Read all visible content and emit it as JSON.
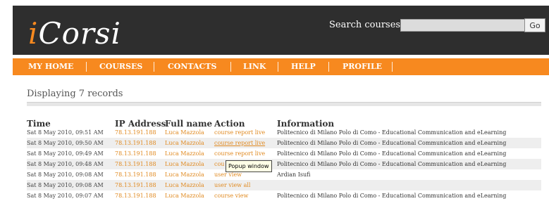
{
  "brand": {
    "logo_first": "i",
    "logo_rest": "Corsi"
  },
  "search": {
    "label": "Search courses",
    "value": "",
    "go_label": "Go"
  },
  "nav": {
    "items": [
      "MY HOME",
      "COURSES",
      "CONTACTS",
      "LINK",
      "HELP",
      "PROFILE"
    ]
  },
  "records_label": "Displaying 7 records",
  "table": {
    "headers": [
      "Time",
      "IP Address",
      "Full name",
      "Action",
      "Information"
    ],
    "rows": [
      {
        "time": "Sat 8 May 2010, 09:51 AM",
        "ip": "78.13.191.188",
        "name": "Luca Mazzola",
        "action": "course report live",
        "info": "Politecnico di Milano Polo di Como - Educational Communication and eLearning"
      },
      {
        "time": "Sat 8 May 2010, 09:50 AM",
        "ip": "78.13.191.188",
        "name": "Luca Mazzola",
        "action": "course report live",
        "info": "Politecnico di Milano Polo di Como - Educational Communication and eLearning"
      },
      {
        "time": "Sat 8 May 2010, 09:49 AM",
        "ip": "78.13.191.188",
        "name": "Luca Mazzola",
        "action": "course report live",
        "info": "Politecnico di Milano Polo di Como - Educational Communication and eLearning"
      },
      {
        "time": "Sat 8 May 2010, 09:48 AM",
        "ip": "78.13.191.188",
        "name": "Luca Mazzola",
        "action": "cou",
        "info": "Politecnico di Milano Polo di Como - Educational Communication and eLearning"
      },
      {
        "time": "Sat 8 May 2010, 09:08 AM",
        "ip": "78.13.191.188",
        "name": "Luca Mazzola",
        "action": "user view",
        "info": "Ardian Isufi"
      },
      {
        "time": "Sat 8 May 2010, 09:08 AM",
        "ip": "78.13.191.188",
        "name": "Luca Mazzola",
        "action": "user view all",
        "info": ""
      },
      {
        "time": "Sat 8 May 2010, 09:07 AM",
        "ip": "78.13.191.188",
        "name": "Luca Mazzola",
        "action": "course view",
        "info": "Politecnico di Milano Polo di Como - Educational Communication and eLearning"
      }
    ]
  },
  "tooltip": "Popup window",
  "colors": {
    "accent": "#f7891f",
    "header_bg": "#2e2e2e",
    "link": "#e0891f"
  }
}
